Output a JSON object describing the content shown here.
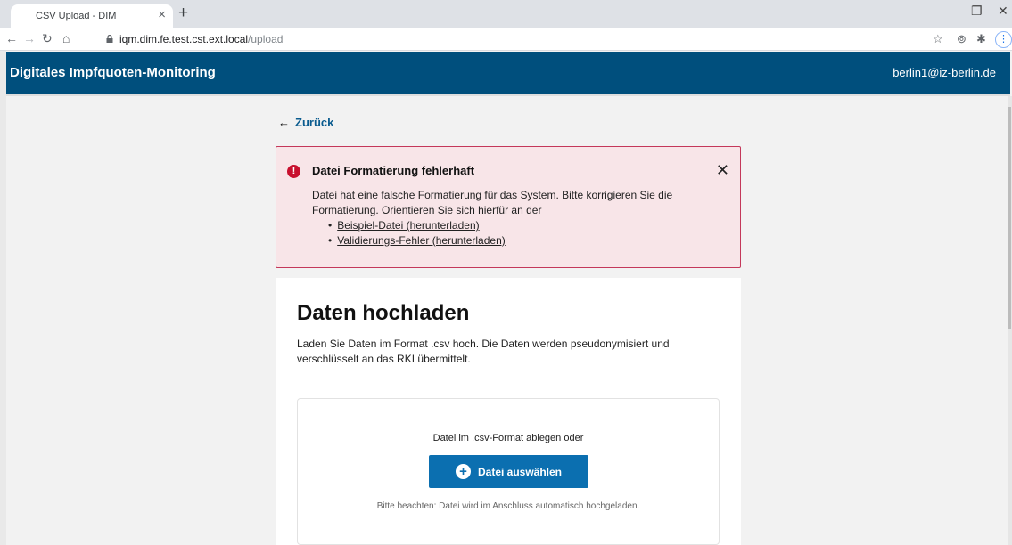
{
  "browser": {
    "tab_title": "CSV Upload - DIM",
    "tab_close": "×",
    "new_tab": "+",
    "url_host": "iqm.dim.fe.test.cst.ext.local",
    "url_path": "/upload",
    "window_controls": {
      "minimize": "–",
      "maximize": "❐",
      "close": "✕"
    }
  },
  "header": {
    "title": "Digitales Impfquoten-Monitoring",
    "user_email": "berlin1@iz-berlin.de"
  },
  "back": {
    "arrow": "←",
    "label": "Zurück"
  },
  "alert": {
    "icon": "!",
    "title": "Datei Formatierung fehlerhaft",
    "close": "✕",
    "message": "Datei hat eine falsche Formatierung für das System. Bitte korrigieren Sie die Formatierung. Orientieren Sie sich hierfür an der",
    "links": [
      "Beispiel-Datei (herunterladen)",
      "Validierungs-Fehler (herunterladen)"
    ]
  },
  "upload": {
    "title": "Daten hochladen",
    "description": "Laden Sie Daten im Format .csv hoch. Die Daten werden pseudonymisiert und verschlüsselt an das RKI übermittelt.",
    "drop_text": "Datei im .csv-Format ablegen oder",
    "button_icon": "+",
    "button_label": "Datei auswählen",
    "note": "Bitte beachten: Datei wird im Anschluss automatisch hochgeladen."
  },
  "colors": {
    "header_bg": "#004f7d",
    "alert_bg": "#f8e5e8",
    "alert_border": "#c4385a",
    "button_bg": "#0b6fb0"
  }
}
